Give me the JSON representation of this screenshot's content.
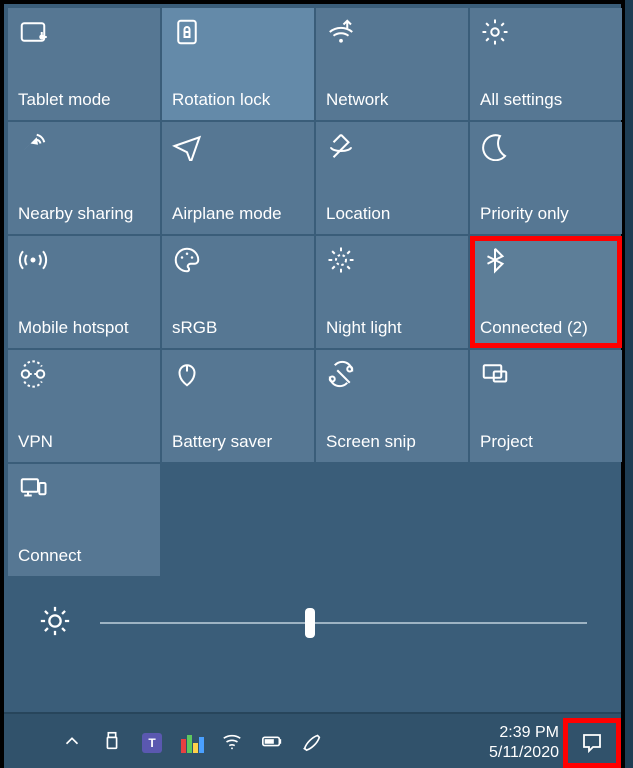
{
  "tiles": [
    {
      "label": "Tablet mode",
      "icon": "tablet",
      "state": "default"
    },
    {
      "label": "Rotation lock",
      "icon": "rotation-lock",
      "state": "active"
    },
    {
      "label": "Network",
      "icon": "network",
      "state": "default"
    },
    {
      "label": "All settings",
      "icon": "settings",
      "state": "default"
    },
    {
      "label": "Nearby sharing",
      "icon": "nearby-sharing",
      "state": "default"
    },
    {
      "label": "Airplane mode",
      "icon": "airplane",
      "state": "default"
    },
    {
      "label": "Location",
      "icon": "location",
      "state": "default"
    },
    {
      "label": "Priority only",
      "icon": "moon",
      "state": "default"
    },
    {
      "label": "Mobile hotspot",
      "icon": "hotspot",
      "state": "default"
    },
    {
      "label": "sRGB",
      "icon": "palette",
      "state": "default"
    },
    {
      "label": "Night light",
      "icon": "night-light",
      "state": "default"
    },
    {
      "label": "Connected (2)",
      "icon": "bluetooth",
      "state": "active2",
      "highlight": true
    },
    {
      "label": "VPN",
      "icon": "vpn",
      "state": "default"
    },
    {
      "label": "Battery saver",
      "icon": "battery-saver",
      "state": "default"
    },
    {
      "label": "Screen snip",
      "icon": "screen-snip",
      "state": "default"
    },
    {
      "label": "Project",
      "icon": "project",
      "state": "default"
    },
    {
      "label": "Connect",
      "icon": "connect",
      "state": "default"
    }
  ],
  "slider": {
    "position": 0.42
  },
  "clock": {
    "time": "2:39 PM",
    "date": "5/11/2020"
  },
  "tray": [
    "chevron-up",
    "usb",
    "teams",
    "powertoys",
    "wifi",
    "battery",
    "pen"
  ]
}
